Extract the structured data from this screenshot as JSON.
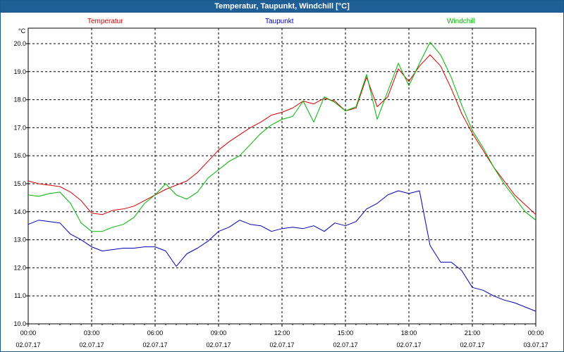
{
  "window": {
    "title": "Temperatur, Taupunkt, Windchill [°C]"
  },
  "chart_data": {
    "type": "line",
    "ylabel": "°C",
    "ylim": [
      10.0,
      20.2
    ],
    "yticks": [
      "10.0",
      "11.0",
      "12.0",
      "13.0",
      "14.0",
      "15.0",
      "16.0",
      "17.0",
      "18.0",
      "19.0",
      "20.0"
    ],
    "xticks": [
      {
        "time": "00:00",
        "date": "02.07.17"
      },
      {
        "time": "03:00",
        "date": "02.07.17"
      },
      {
        "time": "06:00",
        "date": "02.07.17"
      },
      {
        "time": "09:00",
        "date": "02.07.17"
      },
      {
        "time": "12:00",
        "date": "02.07.17"
      },
      {
        "time": "15:00",
        "date": "02.07.17"
      },
      {
        "time": "18:00",
        "date": "02.07.17"
      },
      {
        "time": "21:00",
        "date": "02.07.17"
      },
      {
        "time": "00:00",
        "date": "03.07.17"
      }
    ],
    "grid": true,
    "x_hours": [
      0,
      0.5,
      1,
      1.5,
      2,
      2.5,
      3,
      3.5,
      4,
      4.5,
      5,
      5.5,
      6,
      6.5,
      7,
      7.5,
      8,
      8.5,
      9,
      9.5,
      10,
      10.5,
      11,
      11.5,
      12,
      12.5,
      13,
      13.5,
      14,
      14.5,
      15,
      15.5,
      16,
      16.5,
      17,
      17.5,
      18,
      18.5,
      19,
      19.5,
      20,
      20.5,
      21,
      21.5,
      22,
      22.5,
      23,
      23.5,
      24
    ],
    "series": [
      {
        "name": "Temperatur",
        "color": "#d40000",
        "values": [
          15.1,
          15.0,
          14.95,
          14.9,
          14.7,
          14.4,
          13.95,
          13.9,
          14.05,
          14.1,
          14.2,
          14.4,
          14.6,
          14.8,
          14.95,
          15.1,
          15.4,
          15.8,
          16.2,
          16.5,
          16.75,
          17.0,
          17.2,
          17.45,
          17.55,
          17.7,
          17.95,
          17.85,
          18.05,
          17.95,
          17.6,
          17.7,
          18.8,
          17.75,
          18.1,
          19.1,
          18.65,
          19.2,
          19.6,
          19.2,
          18.4,
          17.5,
          16.8,
          16.2,
          15.6,
          15.1,
          14.6,
          14.25,
          13.9
        ]
      },
      {
        "name": "Taupunkt",
        "color": "#0000b4",
        "values": [
          13.55,
          13.7,
          13.65,
          13.6,
          13.2,
          13.0,
          12.75,
          12.6,
          12.65,
          12.7,
          12.7,
          12.75,
          12.75,
          12.6,
          12.05,
          12.5,
          12.7,
          12.95,
          13.3,
          13.45,
          13.7,
          13.55,
          13.5,
          13.3,
          13.4,
          13.45,
          13.4,
          13.5,
          13.3,
          13.6,
          13.5,
          13.65,
          14.1,
          14.3,
          14.6,
          14.75,
          14.65,
          14.75,
          12.8,
          12.2,
          12.2,
          11.9,
          11.3,
          11.2,
          11.0,
          10.85,
          10.75,
          10.6,
          10.45
        ]
      },
      {
        "name": "Windchill",
        "color": "#00b400",
        "values": [
          14.6,
          14.55,
          14.65,
          14.7,
          14.3,
          13.6,
          13.3,
          13.3,
          13.45,
          13.55,
          13.8,
          14.3,
          14.6,
          15.0,
          14.6,
          14.45,
          14.7,
          15.2,
          15.5,
          15.8,
          16.0,
          16.4,
          16.8,
          17.1,
          17.3,
          17.4,
          17.95,
          17.2,
          18.1,
          17.9,
          17.6,
          17.75,
          18.9,
          17.3,
          18.3,
          19.3,
          18.5,
          19.3,
          20.05,
          19.6,
          18.8,
          17.8,
          16.9,
          16.3,
          15.6,
          15.0,
          14.5,
          14.0,
          13.7
        ]
      }
    ]
  }
}
